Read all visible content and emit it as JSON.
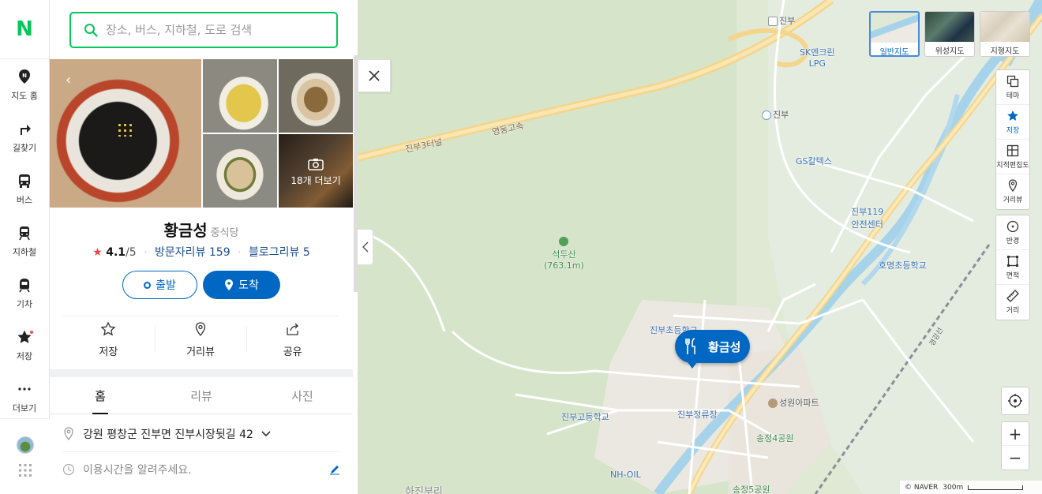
{
  "logo": "N",
  "nav": [
    {
      "icon": "map-pin-icon",
      "label": "지도 홈"
    },
    {
      "icon": "directions-icon",
      "label": "길찾기"
    },
    {
      "icon": "bus-icon",
      "label": "버스"
    },
    {
      "icon": "subway-icon",
      "label": "지하철"
    },
    {
      "icon": "train-icon",
      "label": "기차"
    },
    {
      "icon": "star-icon",
      "label": "저장"
    },
    {
      "icon": "more-icon",
      "label": "더보기"
    }
  ],
  "search": {
    "placeholder": "장소, 버스, 지하철, 도로 검색"
  },
  "place": {
    "name": "황금성",
    "category": "중식당",
    "rating_star": "★",
    "rating": "4.1",
    "rating_max": "/5",
    "visitor_reviews": "방문자리뷰 159",
    "blog_reviews": "블로그리뷰 5",
    "photo_more": "18개 더보기",
    "address": "강원 평창군 진부면 진부시장뒷길 42",
    "hours_placeholder": "이용시간을 알려주세요."
  },
  "buttons": {
    "start": "출발",
    "arrive": "도착"
  },
  "actions": [
    {
      "icon": "star-outline-icon",
      "label": "저장"
    },
    {
      "icon": "location-icon",
      "label": "거리뷰"
    },
    {
      "icon": "share-icon",
      "label": "공유"
    }
  ],
  "tabs": [
    "홈",
    "리뷰",
    "사진"
  ],
  "active_tab": "홈",
  "map": {
    "labels": {
      "ic_jinbu": "진부",
      "sk_lpg": "SK엔크린\nLPG",
      "tg_jinbu": "진부",
      "gs_caltex": "GS칼텍스",
      "fire_center": "진부119\n안전센터",
      "homyeong_school": "호명초등학교",
      "seokdusan": "석두산\n(763.1m)",
      "expressway": "영동고속",
      "tunnel": "진부3터널",
      "jinbu_elem": "진부초등학교",
      "jinbu_high": "진부고등학교",
      "bus_terminal": "진부정류장",
      "seongwon_apt": "성원아파트",
      "songjeong4_park": "송정4공원",
      "nh_oil": "NH-OIL",
      "songjeong5_park": "송정5공원",
      "hajinbu": "하진부리",
      "rail": "경강선"
    },
    "marker_name": "황금성",
    "map_types": [
      {
        "label": "일반지도",
        "active": true
      },
      {
        "label": "위성지도",
        "active": false
      },
      {
        "label": "지형지도",
        "active": false
      }
    ],
    "tools_top": [
      {
        "icon": "theme-icon",
        "label": "테마",
        "active": false
      },
      {
        "icon": "star-icon",
        "label": "저장",
        "active": true
      },
      {
        "icon": "cadastral-icon",
        "label": "지적편집도",
        "active": false
      },
      {
        "icon": "streetview-icon",
        "label": "거리뷰",
        "active": false
      }
    ],
    "tools_measure": [
      {
        "icon": "radius-icon",
        "label": "반경"
      },
      {
        "icon": "area-icon",
        "label": "면적"
      },
      {
        "icon": "ruler-icon",
        "label": "거리"
      }
    ],
    "zoom_in": "+",
    "zoom_out": "−",
    "copyright": "© NAVER",
    "scale": "300m",
    "colors": {
      "accent": "#0068c3",
      "brand": "#03c75a"
    }
  }
}
